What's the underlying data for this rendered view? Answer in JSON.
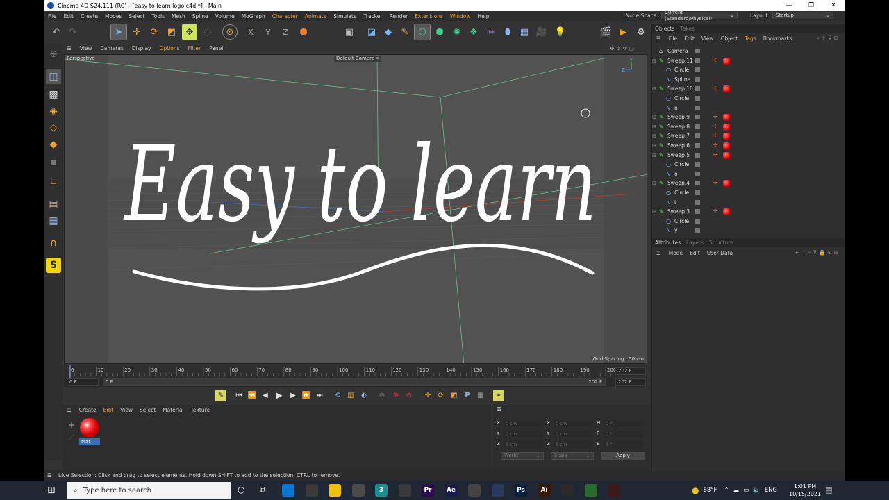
{
  "window": {
    "title": "Cinema 4D S24.111 (RC) - [easy to learn logo.c4d *] - Main",
    "controls": [
      "—",
      "❐",
      "✕"
    ]
  },
  "menubar": {
    "items": [
      "File",
      "Edit",
      "Create",
      "Modes",
      "Select",
      "Tools",
      "Mesh",
      "Spline",
      "Volume",
      "MoGraph",
      "Character",
      "Animate",
      "Simulate",
      "Tracker",
      "Render",
      "Extensions",
      "Window",
      "Help"
    ],
    "highlighted": [
      "Character",
      "Animate",
      "Extensions",
      "Window"
    ],
    "node_space_label": "Node Space:",
    "node_space_value": "Current (Standard/Physical)",
    "layout_label": "Layout:",
    "layout_value": "Startup"
  },
  "viewport": {
    "menu": [
      "View",
      "Cameras",
      "Display",
      "Options",
      "Filter",
      "Panel"
    ],
    "highlighted": [
      "Options",
      "Filter"
    ],
    "view_name": "Perspective",
    "camera": "Default Camera",
    "grid_spacing": "Grid Spacing : 50 cm",
    "logo_text": "Easy to learn",
    "axis_z": "Z",
    "axis_y": "Y"
  },
  "timeline": {
    "ticks": [
      "0",
      "10",
      "20",
      "30",
      "40",
      "50",
      "60",
      "70",
      "80",
      "90",
      "100",
      "110",
      "120",
      "130",
      "140",
      "150",
      "160",
      "170",
      "180",
      "190",
      "200"
    ],
    "current_frame": "0 F",
    "range_start": "0 F",
    "range_end": "202 F",
    "end_field": "202 F",
    "end_field2": "202 F"
  },
  "material_manager": {
    "menu": [
      "Create",
      "Edit",
      "View",
      "Select",
      "Material",
      "Texture"
    ],
    "highlighted": [
      "Edit"
    ],
    "material_name": "Mat"
  },
  "coordinates": {
    "rows": [
      {
        "a": "X",
        "av": "0 cm",
        "b": "X",
        "bv": "0 cm",
        "c": "H",
        "cv": "0 °"
      },
      {
        "a": "Y",
        "av": "0 cm",
        "b": "Y",
        "bv": "0 cm",
        "c": "P",
        "cv": "0 °"
      },
      {
        "a": "Z",
        "av": "0 cm",
        "b": "Z",
        "bv": "0 cm",
        "c": "B",
        "cv": "0 °"
      }
    ],
    "space": "World",
    "mode": "Scale",
    "apply": "Apply"
  },
  "objects_panel": {
    "tabs": [
      "Objects",
      "Takes"
    ],
    "menu": [
      "File",
      "Edit",
      "View",
      "Object",
      "Tags",
      "Bookmarks"
    ],
    "highlighted": [
      "Tags"
    ],
    "rows": [
      {
        "name": "Camera",
        "indent": 0,
        "icon": "camera",
        "mat": false
      },
      {
        "name": "Sweep.11",
        "indent": 0,
        "icon": "sweep",
        "mat": true
      },
      {
        "name": "Circle",
        "indent": 1,
        "icon": "circle",
        "mat": false
      },
      {
        "name": "Spline",
        "indent": 1,
        "icon": "spline",
        "mat": false
      },
      {
        "name": "Sweep.10",
        "indent": 0,
        "icon": "sweep",
        "mat": true
      },
      {
        "name": "Circle",
        "indent": 1,
        "icon": "circle",
        "mat": false
      },
      {
        "name": "n",
        "indent": 1,
        "icon": "spline",
        "mat": false
      },
      {
        "name": "Sweep.9",
        "indent": 0,
        "icon": "sweep",
        "mat": true
      },
      {
        "name": "Sweep.8",
        "indent": 0,
        "icon": "sweep",
        "mat": true
      },
      {
        "name": "Sweep.7",
        "indent": 0,
        "icon": "sweep",
        "mat": true
      },
      {
        "name": "Sweep.6",
        "indent": 0,
        "icon": "sweep",
        "mat": true
      },
      {
        "name": "Sweep.5",
        "indent": 0,
        "icon": "sweep",
        "mat": true
      },
      {
        "name": "Circle",
        "indent": 1,
        "icon": "circle",
        "mat": false
      },
      {
        "name": "o",
        "indent": 1,
        "icon": "spline",
        "mat": false
      },
      {
        "name": "Sweep.4",
        "indent": 0,
        "icon": "sweep",
        "mat": true
      },
      {
        "name": "Circle",
        "indent": 1,
        "icon": "circle",
        "mat": false
      },
      {
        "name": "t",
        "indent": 1,
        "icon": "spline",
        "mat": false
      },
      {
        "name": "Sweep.3",
        "indent": 0,
        "icon": "sweep",
        "mat": true
      },
      {
        "name": "Circle",
        "indent": 1,
        "icon": "circle",
        "mat": false
      },
      {
        "name": "y",
        "indent": 1,
        "icon": "spline",
        "mat": false
      }
    ]
  },
  "attributes_panel": {
    "tabs": [
      "Attributes",
      "Layers",
      "Structure"
    ],
    "menu": [
      "Mode",
      "Edit",
      "User Data"
    ]
  },
  "status_bar": {
    "text": "Live Selection: Click and drag to select elements. Hold down SHIFT to add to the selection, CTRL to remove."
  },
  "taskbar": {
    "search_placeholder": "Type here to search",
    "weather": "88°F",
    "language": "ENG",
    "time": "1:01 PM",
    "date": "10/15/2021",
    "apps": [
      {
        "label": "",
        "color": "#0078d4"
      },
      {
        "label": "",
        "color": "#3a3a3a"
      },
      {
        "label": "",
        "color": "#f2c200"
      },
      {
        "label": "",
        "color": "#4a4a4a"
      },
      {
        "label": "3",
        "color": "#1b8f8f"
      },
      {
        "label": "",
        "color": "#3a3a3a"
      },
      {
        "label": "Pr",
        "color": "#2a0a4a"
      },
      {
        "label": "Ae",
        "color": "#1b1b4a"
      },
      {
        "label": "",
        "color": "#444"
      },
      {
        "label": "",
        "color": "#2a3a5a"
      },
      {
        "label": "Ps",
        "color": "#0b1f3a"
      },
      {
        "label": "Ai",
        "color": "#3a1a00"
      },
      {
        "label": "",
        "color": "#2a2a2a"
      },
      {
        "label": "",
        "color": "#2a6a2a"
      },
      {
        "label": "",
        "color": "#3a1a1a"
      }
    ]
  }
}
